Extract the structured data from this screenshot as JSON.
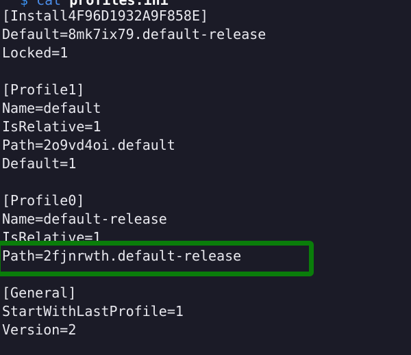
{
  "prompt": {
    "symbol": "$",
    "command": "cat",
    "argument": "profiles.ini"
  },
  "lines": [
    "[Install4F96D1932A9F858E]",
    "Default=8mk7ix79.default-release",
    "Locked=1",
    "",
    "[Profile1]",
    "Name=default",
    "IsRelative=1",
    "Path=2o9vd4oi.default",
    "Default=1",
    "",
    "[Profile0]",
    "Name=default-release",
    "IsRelative=1",
    "Path=2fjnrwth.default-release",
    "",
    "[General]",
    "StartWithLastProfile=1",
    "Version=2"
  ],
  "highlight": {
    "color": "#0a7d0a",
    "target_line": "Path=2fjnrwth.default-release"
  },
  "colors": {
    "background": "#1b1b27",
    "text": "#e8e8ee",
    "prompt": "#3b8eea"
  }
}
